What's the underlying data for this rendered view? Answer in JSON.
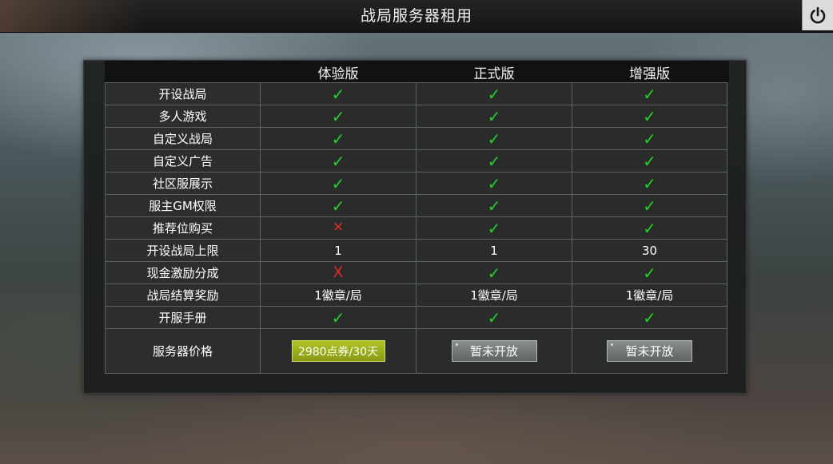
{
  "window": {
    "title": "战局服务器租用"
  },
  "colors": {
    "check": "#22d02a",
    "cross": "#e02a22",
    "buy_button": "#a0b21c",
    "disabled_button": "#777a7a"
  },
  "columns": [
    "",
    "体验版",
    "正式版",
    "增强版"
  ],
  "rows": [
    {
      "label": "开设战局",
      "values": [
        {
          "type": "check"
        },
        {
          "type": "check"
        },
        {
          "type": "check"
        }
      ]
    },
    {
      "label": "多人游戏",
      "values": [
        {
          "type": "check"
        },
        {
          "type": "check"
        },
        {
          "type": "check"
        }
      ]
    },
    {
      "label": "自定义战局",
      "values": [
        {
          "type": "check"
        },
        {
          "type": "check"
        },
        {
          "type": "check"
        }
      ]
    },
    {
      "label": "自定义广告",
      "values": [
        {
          "type": "check"
        },
        {
          "type": "check"
        },
        {
          "type": "check"
        }
      ]
    },
    {
      "label": "社区服展示",
      "values": [
        {
          "type": "check"
        },
        {
          "type": "check"
        },
        {
          "type": "check"
        }
      ]
    },
    {
      "label": "服主GM权限",
      "values": [
        {
          "type": "check"
        },
        {
          "type": "check"
        },
        {
          "type": "check"
        }
      ]
    },
    {
      "label": "推荐位购买",
      "values": [
        {
          "type": "cross",
          "text": "✕"
        },
        {
          "type": "check"
        },
        {
          "type": "check"
        }
      ]
    },
    {
      "label": "开设战局上限",
      "values": [
        {
          "type": "text",
          "text": "1"
        },
        {
          "type": "text",
          "text": "1"
        },
        {
          "type": "text",
          "text": "30"
        }
      ]
    },
    {
      "label": "现金激励分成",
      "values": [
        {
          "type": "crossx",
          "text": "X"
        },
        {
          "type": "check"
        },
        {
          "type": "check"
        }
      ]
    },
    {
      "label": "战局结算奖励",
      "values": [
        {
          "type": "text",
          "text": "1徽章/局"
        },
        {
          "type": "text",
          "text": "1徽章/局"
        },
        {
          "type": "text",
          "text": "1徽章/局"
        }
      ]
    },
    {
      "label": "开服手册",
      "values": [
        {
          "type": "check"
        },
        {
          "type": "check"
        },
        {
          "type": "check"
        }
      ]
    }
  ],
  "check_glyph": "✓",
  "price_row": {
    "label": "服务器价格",
    "trial_button": "2980点券/30天",
    "standard_button": "暂未开放",
    "enhanced_button": "暂未开放"
  },
  "icons": {
    "power": "power-icon"
  }
}
